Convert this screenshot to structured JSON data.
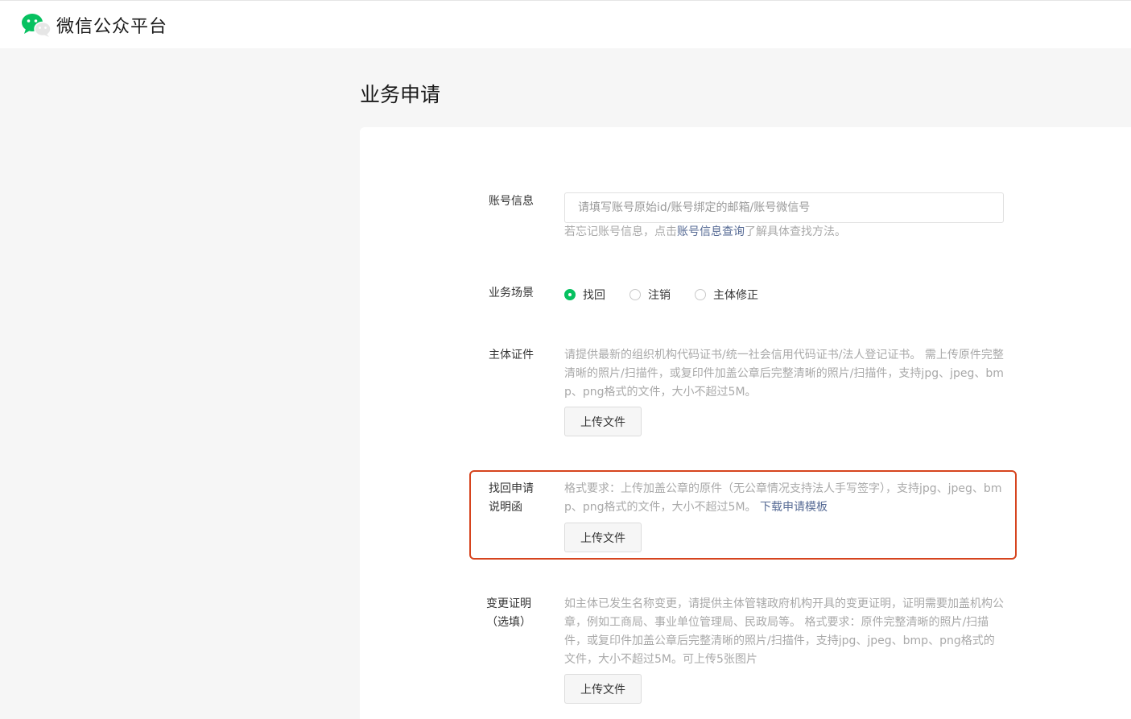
{
  "header": {
    "brand": "微信公众平台"
  },
  "page": {
    "title": "业务申请"
  },
  "account": {
    "label": "账号信息",
    "placeholder": "请填写账号原始id/账号绑定的邮箱/账号微信号",
    "tip_prefix": "若忘记账号信息，点击",
    "tip_link": "账号信息查询",
    "tip_suffix": "了解具体查找方法。"
  },
  "scene": {
    "label": "业务场景",
    "options": [
      {
        "label": "找回",
        "checked": true
      },
      {
        "label": "注销",
        "checked": false
      },
      {
        "label": "主体修正",
        "checked": false
      }
    ]
  },
  "subject_cert": {
    "label": "主体证件",
    "description": "请提供最新的组织机构代码证书/统一社会信用代码证书/法人登记证书。 需上传原件完整清晰的照片/扫描件，或复印件加盖公章后完整清晰的照片/扫描件，支持jpg、jpeg、bmp、png格式的文件，大小不超过5M。",
    "upload_label": "上传文件"
  },
  "recovery_letter": {
    "label_line1": "找回申请",
    "label_line2": "说明函",
    "description": "格式要求：上传加盖公章的原件（无公章情况支持法人手写签字），支持jpg、jpeg、bmp、png格式的文件，大小不超过5M。",
    "template_link": "下载申请模板",
    "upload_label": "上传文件"
  },
  "change_proof": {
    "label_line1": "变更证明",
    "label_line2": "（选填）",
    "description": "如主体已发生名称变更，请提供主体管辖政府机构开具的变更证明，证明需要加盖机构公章，例如工商局、事业单位管理局、民政局等。 格式要求：原件完整清晰的照片/扫描件，或复印件加盖公章后完整清晰的照片/扫描件，支持jpg、jpeg、bmp、png格式的文件，大小不超过5M。可上传5张图片",
    "upload_label": "上传文件"
  },
  "colors": {
    "brand_green": "#07c160",
    "link": "#576b95",
    "highlight_border": "#d6441e"
  }
}
